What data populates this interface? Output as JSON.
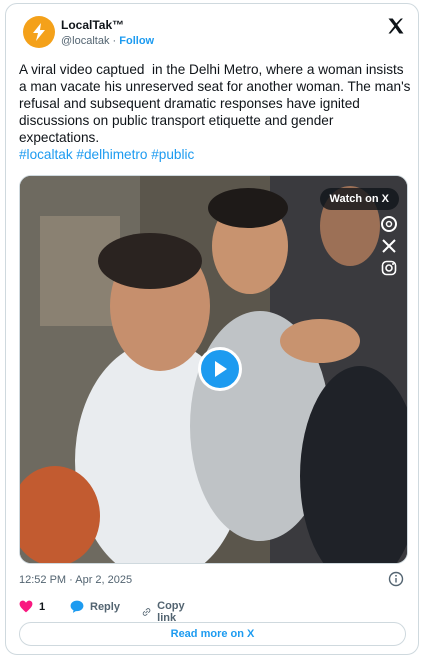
{
  "account": {
    "name": "LocalTak™",
    "handle": "@localtak",
    "separator": "·",
    "follow_label": "Follow"
  },
  "tweet": {
    "text": "A viral video captued  in the Delhi Metro, where a woman insists a man vacate his unreserved seat for another woman. The man's refusal and subsequent dramatic responses have ignited discussions on public transport etiquette and gender expectations.",
    "hashtags": "#localtak #delhimetro #public"
  },
  "media": {
    "watch_label": "Watch on X",
    "icons": [
      "threads-icon",
      "x-icon",
      "instagram-icon"
    ]
  },
  "meta": {
    "timestamp": "12:52 PM · Apr 2, 2025"
  },
  "actions": {
    "like_count": "1",
    "reply_label": "Reply",
    "copy_link_label": "Copy link"
  },
  "read_more_label": "Read more on X",
  "colors": {
    "accent": "#1d9bf0",
    "like": "#f91880",
    "text": "#0f1419",
    "muted": "#536471",
    "border": "#cfd9de"
  }
}
